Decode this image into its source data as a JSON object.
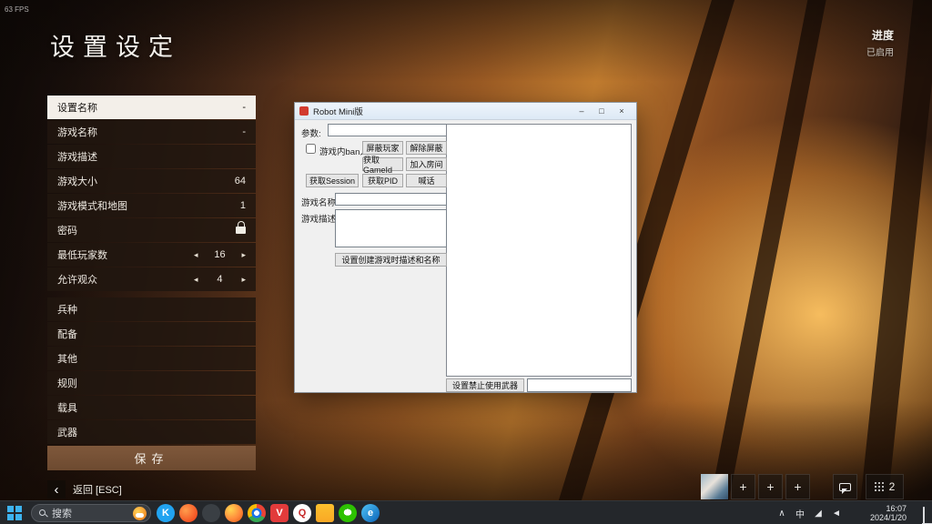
{
  "hud": {
    "fps": "63 FPS",
    "title": "设置设定",
    "progress_label": "进度",
    "progress_state": "已启用",
    "back_arrow": "‹",
    "back_label": "返回 [ESC]"
  },
  "settings_panel": {
    "rows": [
      {
        "label": "设置名称",
        "value": "-"
      },
      {
        "label": "游戏名称",
        "value": "-"
      },
      {
        "label": "游戏描述",
        "value": ""
      },
      {
        "label": "游戏大小",
        "value": "64"
      },
      {
        "label": "游戏模式和地图",
        "value": "1"
      },
      {
        "label": "密码",
        "value": ""
      },
      {
        "label": "最低玩家数",
        "value": "16"
      },
      {
        "label": "允许观众",
        "value": "4"
      }
    ],
    "categories": [
      "兵种",
      "配备",
      "其他",
      "规则",
      "载具",
      "武器"
    ],
    "arrow_left": "◂",
    "arrow_right": "▸",
    "save_label": "保存"
  },
  "dialog": {
    "title": "Robot Mini版",
    "window_controls": {
      "minimize": "–",
      "maximize": "□",
      "close": "×"
    },
    "param_label": "参数:",
    "param_value": "",
    "ban_checkbox_label": "游戏内ban人",
    "buttons": {
      "block": "屏蔽玩家",
      "unblock": "解除屏蔽",
      "get_gameid": "获取GameId",
      "join_room": "加入房间",
      "get_session": "获取Session",
      "get_pid": "获取PID",
      "shout": "喊话",
      "set_create": "设置创建游戏时描述和名称",
      "ban_weapon": "设置禁止使用武器"
    },
    "name_label": "游戏名称:",
    "name_value": "",
    "desc_label": "游戏描述:",
    "desc_value": "",
    "ban_weapon_value": ""
  },
  "squad_bar": {
    "plus": "+",
    "count": "2"
  },
  "taskbar": {
    "search_label": "搜索",
    "apps": [
      {
        "glyph": "K",
        "style": "background:#21a3f1"
      },
      {
        "glyph": "",
        "style": "background:radial-gradient(circle at 35% 35%, #ff9d4d, #f25022 75%)"
      },
      {
        "glyph": "",
        "style": "background:#3a3f44"
      },
      {
        "glyph": "",
        "style": "background:radial-gradient(circle at 32% 30%, #ffd54f, #ff8a3c 55%, #e4590f)"
      },
      {
        "glyph": "",
        "style": "background:radial-gradient(circle at 50% 50%, #fff 0 3px, #1a73e8 3px 5.5px, rgba(0,0,0,0) 5.5px), conic-gradient(#ea4335 0deg 120deg, #34a853 120deg 240deg, #fbbc05 240deg 360deg)"
      },
      {
        "glyph": "V",
        "style": "background:#e23b3b;border-radius:4px"
      },
      {
        "glyph": "Q",
        "style": "background:#ffffff;color:#c62828"
      },
      {
        "glyph": "",
        "style": "background:linear-gradient(#fbc02d,#f9a825);border-radius:3px"
      },
      {
        "glyph": "",
        "style": "background:radial-gradient(ellipse 6px 5px at 50% 46%, #fff 70%, rgba(0,0,0,0) 72%), #2dc100"
      },
      {
        "glyph": "e",
        "style": "background:linear-gradient(135deg,#4fc3f7,#0b63b6)"
      }
    ],
    "tray": {
      "chevron": "∧",
      "ime": "中",
      "network": "◢",
      "volume": "◄"
    },
    "time": "16:07",
    "date": "2024/1/20"
  }
}
